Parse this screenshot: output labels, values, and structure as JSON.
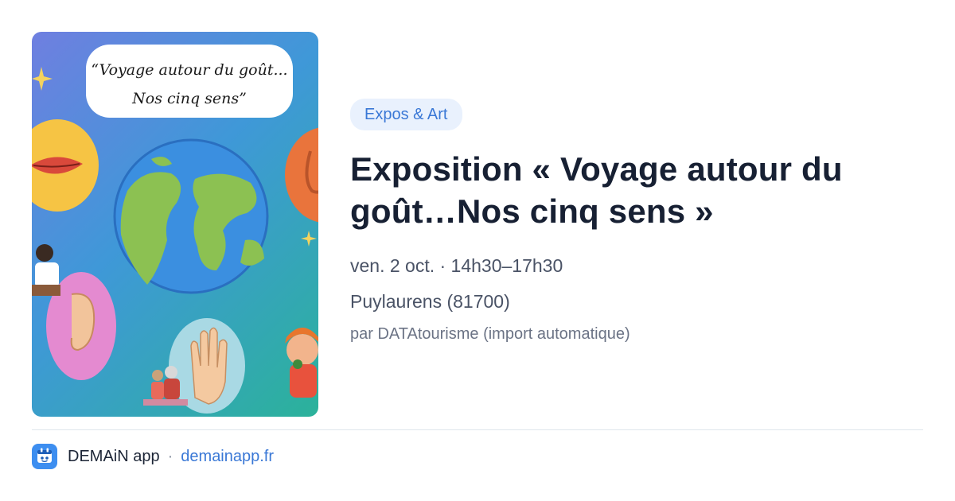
{
  "image": {
    "headline_line1": "“Voyage autour du goût...",
    "headline_line2": "Nos cinq sens”"
  },
  "event": {
    "category": "Expos & Art",
    "title": "Exposition « Voyage autour du goût…Nos cinq sens »",
    "date_time": "ven. 2 oct. · 14h30–17h30",
    "location": "Puylaurens (81700)",
    "source": "par DATAtourisme (import automatique)"
  },
  "footer": {
    "app_name": "DEMAiN app",
    "separator": "·",
    "domain": "demainapp.fr"
  },
  "colors": {
    "tag_bg": "#e9f1fd",
    "accent": "#3a78d6",
    "logo_bg": "#3d8ef0"
  },
  "icons": {
    "app_logo": "demain-app-icon",
    "sparkle": "sparkle-icon"
  }
}
